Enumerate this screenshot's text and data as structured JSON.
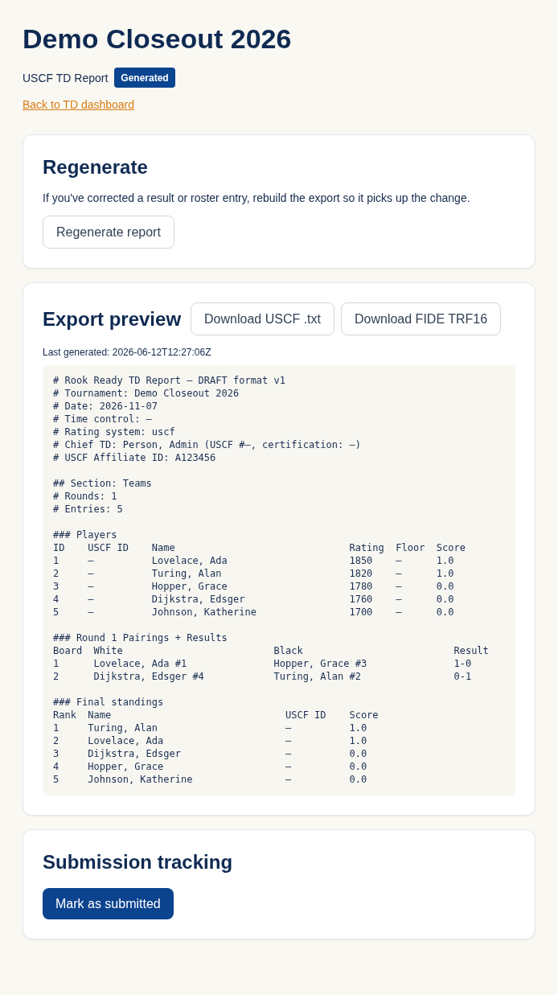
{
  "page": {
    "title": "Demo Closeout 2026",
    "subtitle": "USCF TD Report",
    "status_badge": "Generated",
    "back_link": "Back to TD dashboard"
  },
  "regenerate": {
    "title": "Regenerate",
    "description": "If you've corrected a result or roster entry, rebuild the export so it picks up the change.",
    "button": "Regenerate report"
  },
  "export_preview": {
    "title": "Export preview",
    "buttons": [
      "Download USCF .txt",
      "Download FIDE TRF16"
    ],
    "last_generated": "Last generated: 2026-06-12T12:27:06Z",
    "report": {
      "header_lines": [
        "# Rook Ready TD Report — DRAFT format v1",
        "# Tournament: Demo Closeout 2026",
        "# Date: 2026-11-07",
        "# Time control: —",
        "# Rating system: uscf",
        "# Chief TD: Person, Admin (USCF #—, certification: —)",
        "# USCF Affiliate ID: A123456"
      ],
      "section_lines": [
        "## Section: Teams",
        "# Rounds: 1",
        "# Entries: 5"
      ],
      "tables": [
        {
          "kind": "players",
          "heading": "### Players",
          "columns": [
            "ID",
            "USCF ID",
            "Name",
            "Rating",
            "Floor",
            "Score"
          ],
          "rows": [
            [
              "1",
              "—",
              "Lovelace, Ada",
              "1850",
              "—",
              "1.0"
            ],
            [
              "2",
              "—",
              "Turing, Alan",
              "1820",
              "—",
              "1.0"
            ],
            [
              "3",
              "—",
              "Hopper, Grace",
              "1780",
              "—",
              "0.0"
            ],
            [
              "4",
              "—",
              "Dijkstra, Edsger",
              "1760",
              "—",
              "0.0"
            ],
            [
              "5",
              "—",
              "Johnson, Katherine",
              "1700",
              "—",
              "0.0"
            ]
          ]
        },
        {
          "kind": "pairings",
          "heading": "### Round 1 Pairings + Results",
          "columns": [
            "Board",
            "White",
            "Black",
            "Result"
          ],
          "rows": [
            [
              "1",
              "Lovelace, Ada #1",
              "Hopper, Grace #3",
              "1-0"
            ],
            [
              "2",
              "Dijkstra, Edsger #4",
              "Turing, Alan #2",
              "0-1"
            ]
          ]
        },
        {
          "kind": "standings",
          "heading": "### Final standings",
          "columns": [
            "Rank",
            "Name",
            "USCF ID",
            "Score"
          ],
          "rows": [
            [
              "1",
              "Turing, Alan",
              "—",
              "1.0"
            ],
            [
              "2",
              "Lovelace, Ada",
              "—",
              "1.0"
            ],
            [
              "3",
              "Dijkstra, Edsger",
              "—",
              "0.0"
            ],
            [
              "4",
              "Hopper, Grace",
              "—",
              "0.0"
            ],
            [
              "5",
              "Johnson, Katherine",
              "—",
              "0.0"
            ]
          ]
        }
      ]
    }
  },
  "submission": {
    "title": "Submission tracking",
    "button": "Mark as submitted"
  }
}
